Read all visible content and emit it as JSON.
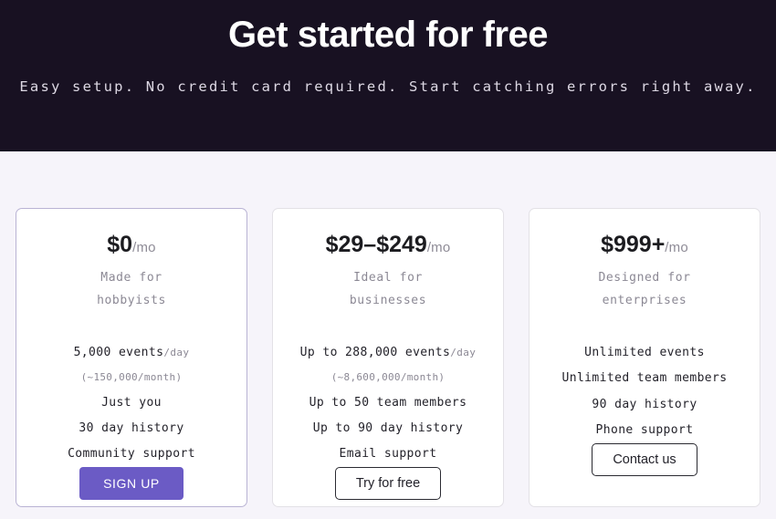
{
  "hero": {
    "title": "Get started for free",
    "subtitle": "Easy setup. No credit card required. Start catching errors right away."
  },
  "colors": {
    "hero_background": "#181122",
    "page_background": "#f6f4fa",
    "accent_purple": "#6b5bc5",
    "accent_card_border": "#b9b3d4",
    "card_border": "#e3e1e6"
  },
  "plans": [
    {
      "price": "$0",
      "price_unit": "/mo",
      "tagline": "Made for hobbyists",
      "features": [
        {
          "text": "5,000 events",
          "unit": "/day",
          "style": "normal"
        },
        {
          "text": "(~150,000/month)",
          "unit": "",
          "style": "muted"
        },
        {
          "text": "Just you",
          "unit": "",
          "style": "normal"
        },
        {
          "text": "30 day history",
          "unit": "",
          "style": "normal"
        },
        {
          "text": "Community support",
          "unit": "",
          "style": "normal"
        }
      ],
      "cta": "SIGN UP",
      "cta_style": "filled"
    },
    {
      "price": "$29–$249",
      "price_unit": "/mo",
      "tagline": "Ideal for businesses",
      "features": [
        {
          "text": "Up to 288,000 events",
          "unit": "/day",
          "style": "normal"
        },
        {
          "text": "(~8,600,000/month)",
          "unit": "",
          "style": "muted"
        },
        {
          "text": "Up to 50 team members",
          "unit": "",
          "style": "normal"
        },
        {
          "text": "Up to 90 day history",
          "unit": "",
          "style": "normal"
        },
        {
          "text": "Email support",
          "unit": "",
          "style": "normal"
        }
      ],
      "cta": "Try for free",
      "cta_style": "outline"
    },
    {
      "price": "$999+",
      "price_unit": "/mo",
      "tagline": "Designed for enterprises",
      "features": [
        {
          "text": "Unlimited events",
          "unit": "",
          "style": "normal"
        },
        {
          "text": "Unlimited team members",
          "unit": "",
          "style": "normal"
        },
        {
          "text": "90 day history",
          "unit": "",
          "style": "normal"
        },
        {
          "text": "Phone support",
          "unit": "",
          "style": "normal"
        }
      ],
      "cta": "Contact us",
      "cta_style": "outline"
    }
  ]
}
